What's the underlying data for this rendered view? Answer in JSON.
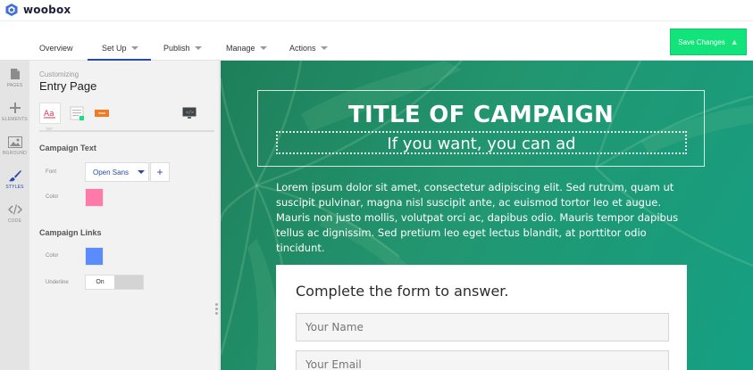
{
  "app": {
    "brand": "woobox"
  },
  "nav": {
    "tabs": [
      {
        "label": "Overview"
      },
      {
        "label": "Set Up"
      },
      {
        "label": "Publish"
      },
      {
        "label": "Manage"
      },
      {
        "label": "Actions"
      }
    ],
    "active_tab": "Set Up",
    "save_label": "Save Changes"
  },
  "rail": {
    "items": [
      {
        "label": "PAGES",
        "icon": "pages-icon"
      },
      {
        "label": "ELEMENTS",
        "icon": "plus-icon"
      },
      {
        "label": "BGROUND",
        "icon": "image-icon"
      },
      {
        "label": "STYLES",
        "icon": "brush-icon"
      },
      {
        "label": "CODE",
        "icon": "code-icon"
      }
    ],
    "active": "STYLES"
  },
  "panel": {
    "subtitle": "Customizing",
    "title": "Entry Page",
    "campaign_text": {
      "heading": "Campaign Text",
      "font_label": "Font",
      "font_value": "Open Sans",
      "color_label": "Color",
      "color_value": "#ff7aa8"
    },
    "campaign_links": {
      "heading": "Campaign Links",
      "color_label": "Color",
      "color_value": "#5b8cff",
      "underline_label": "Underline",
      "underline_value": "On"
    }
  },
  "preview": {
    "title": "TITLE OF CAMPAIGN",
    "subtitle": "If you want, you can ad",
    "body": "Lorem ipsum dolor sit amet, consectetur adipiscing elit. Sed rutrum, quam ut suscipit pulvinar, magna nisl suscipit ante, ac euismod tortor leo et augue. Mauris non justo mollis, volutpat orci ac, dapibus odio. Mauris tempor dapibus tellus ac dignissim. Sed pretium leo eget lectus blandit, at porttitor odio tincidunt.",
    "form": {
      "heading": "Complete the form to answer.",
      "name_placeholder": "Your Name",
      "email_placeholder": "Your Email"
    },
    "bg_color": "#1f8a64"
  },
  "colors": {
    "accent": "#2b4aa8",
    "save": "#12e37a"
  }
}
